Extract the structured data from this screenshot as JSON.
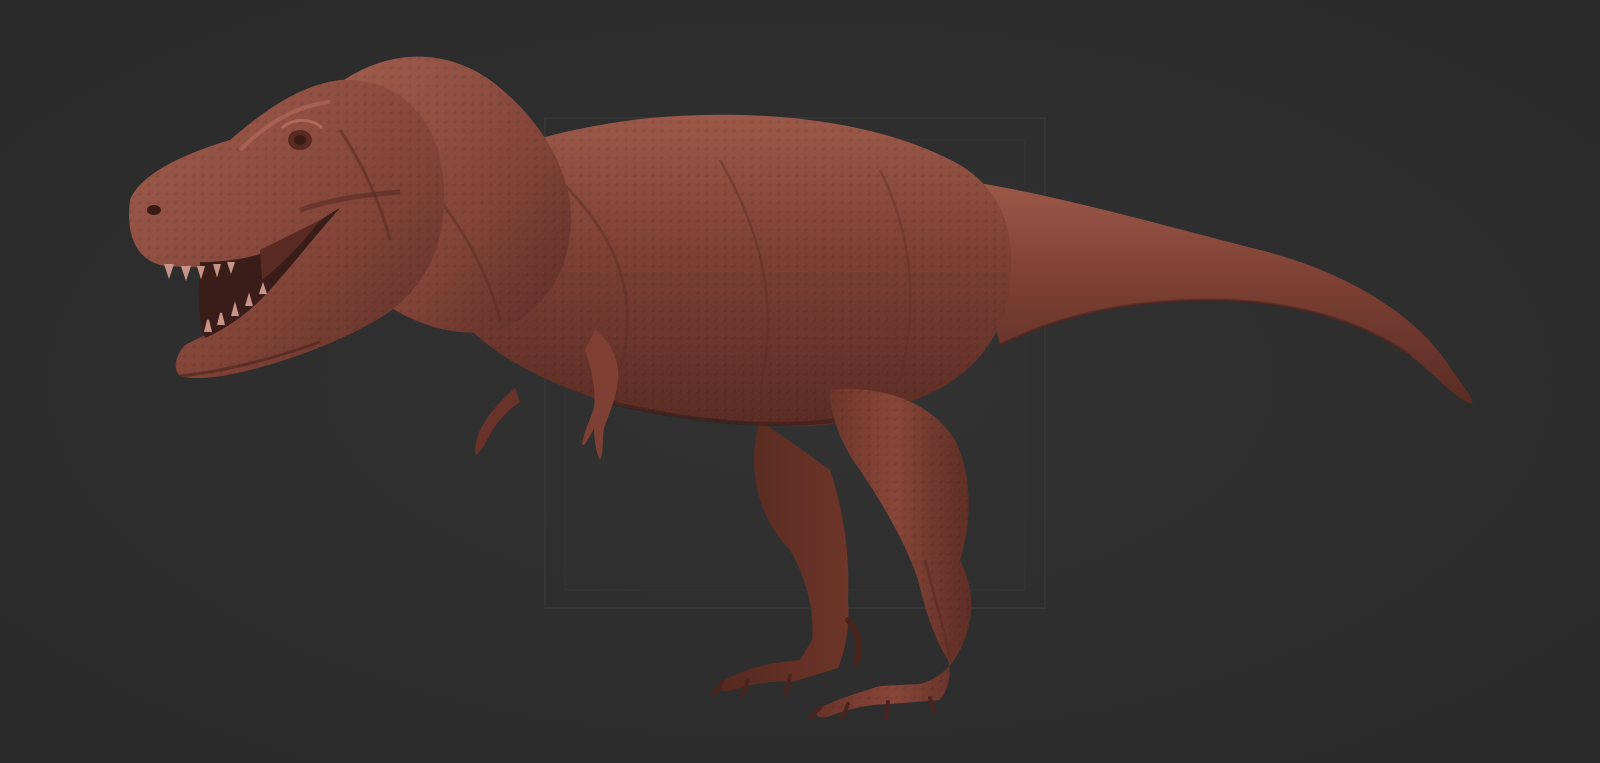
{
  "scene": {
    "background_color": "#2f2f2f",
    "frame_outline_color": "#353535",
    "subject": "tyrannosaurus-sculpt",
    "material": {
      "base": "#7a3e33",
      "light": "#9a5748",
      "highlight": "#b06a5a",
      "shadow": "#4f2620",
      "deep_shadow": "#3a1c18",
      "teeth": "#c79587",
      "eye": "#5a2a22"
    }
  }
}
